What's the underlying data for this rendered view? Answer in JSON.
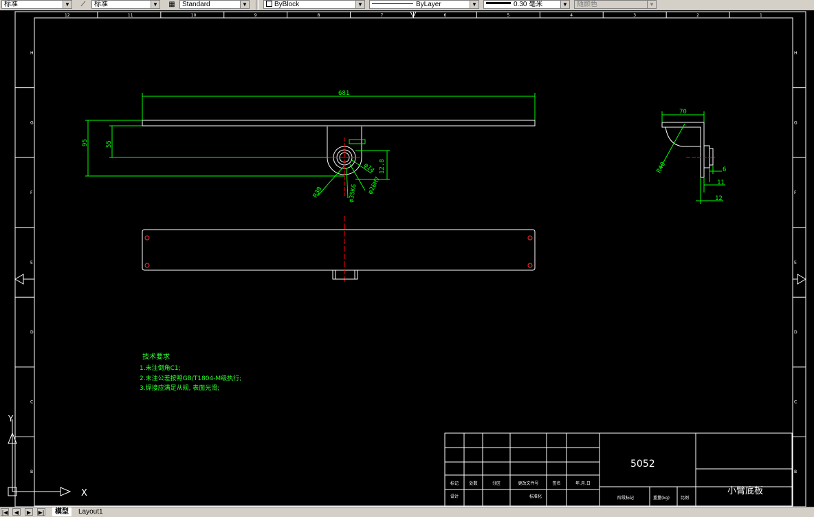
{
  "toolbar": {
    "text_style": "标准",
    "dim_style": "标准",
    "table_style": "Standard",
    "layer_color": "ByBlock",
    "linetype": "ByLayer",
    "lineweight": "0.30 毫米",
    "plot_color": "随颜色"
  },
  "ruler": {
    "top": [
      "12",
      "11",
      "10",
      "9",
      "8",
      "7",
      "6",
      "5",
      "4",
      "3",
      "2",
      "1"
    ],
    "side": [
      "H",
      "G",
      "F",
      "E",
      "D",
      "C",
      "B"
    ]
  },
  "drawing": {
    "dimensions": {
      "length": "681",
      "height_total": "95",
      "height_inner": "55",
      "radius_30": "R30",
      "dia_35": "φ35K6",
      "dia_20": "φ20H7",
      "dia_14": "φ14",
      "gap_12": "12.8",
      "side_width": "70",
      "side_radius": "R40",
      "side_6": "6",
      "side_11": "11",
      "side_12": "12"
    }
  },
  "tech_notes": {
    "title": "技术要求",
    "items": [
      "1.未注倒角C1;",
      "2.未注公差按照GB/T1804-M级执行;",
      "3.焊接应满足从规, 表面光滑;"
    ]
  },
  "title_block": {
    "drawing_number": "5052",
    "part_name": "小臂底板",
    "row_labels": [
      "标记",
      "处数",
      "分区",
      "更改文件号",
      "签名",
      "年.月.日"
    ],
    "design_label": "设计",
    "std_label": "标准化",
    "stage_label": "阶段标记",
    "weight_label": "重量(kg)",
    "scale_label": "比例"
  },
  "ucs": {
    "x_label": "X",
    "y_label": "Y"
  },
  "status": {
    "tabs": [
      "模型",
      "Layout1"
    ],
    "active_tab": "模型"
  },
  "colors": {
    "background": "#000000",
    "geometry": "#ffffff",
    "dimension": "#00ff00",
    "center": "#ff0000"
  }
}
